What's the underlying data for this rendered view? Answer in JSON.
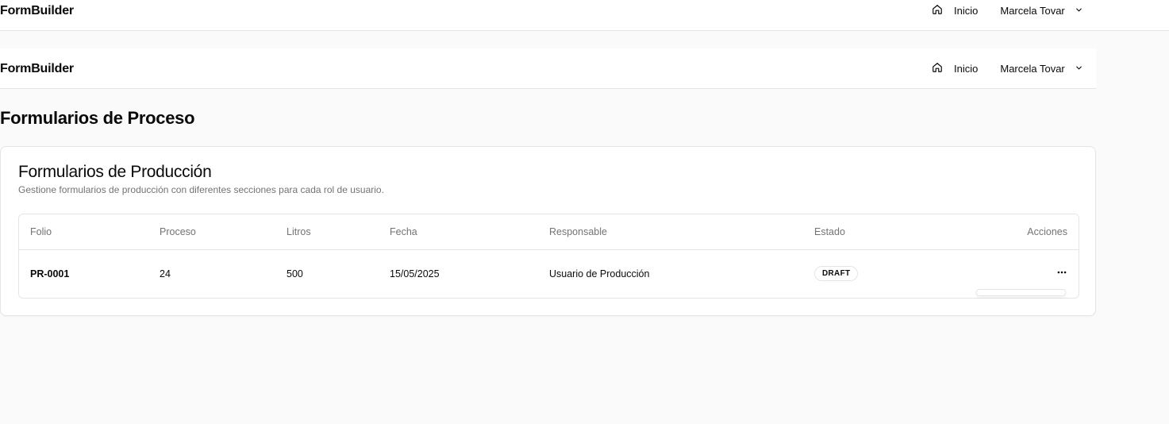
{
  "app": {
    "brand": "FormBuilder"
  },
  "nav": {
    "home_label": "Inicio",
    "user_name": "Marcela Tovar"
  },
  "page": {
    "title": "Formularios de Proceso"
  },
  "card": {
    "title": "Formularios de Producción",
    "description": "Gestione formularios de producción con diferentes secciones para cada rol de usuario."
  },
  "table": {
    "headers": {
      "folio": "Folio",
      "proceso": "Proceso",
      "litros": "Litros",
      "fecha": "Fecha",
      "responsable": "Responsable",
      "estado": "Estado",
      "acciones": "Acciones"
    },
    "rows": [
      {
        "folio": "PR-0001",
        "proceso": "24",
        "litros": "500",
        "fecha": "15/05/2025",
        "responsable": "Usuario de Producción",
        "estado": "DRAFT",
        "actions_icon": "more-horizontal-icon"
      }
    ]
  },
  "colors": {
    "border": "#e5e5e5",
    "muted_text": "#737373",
    "background": "#fafafa"
  }
}
